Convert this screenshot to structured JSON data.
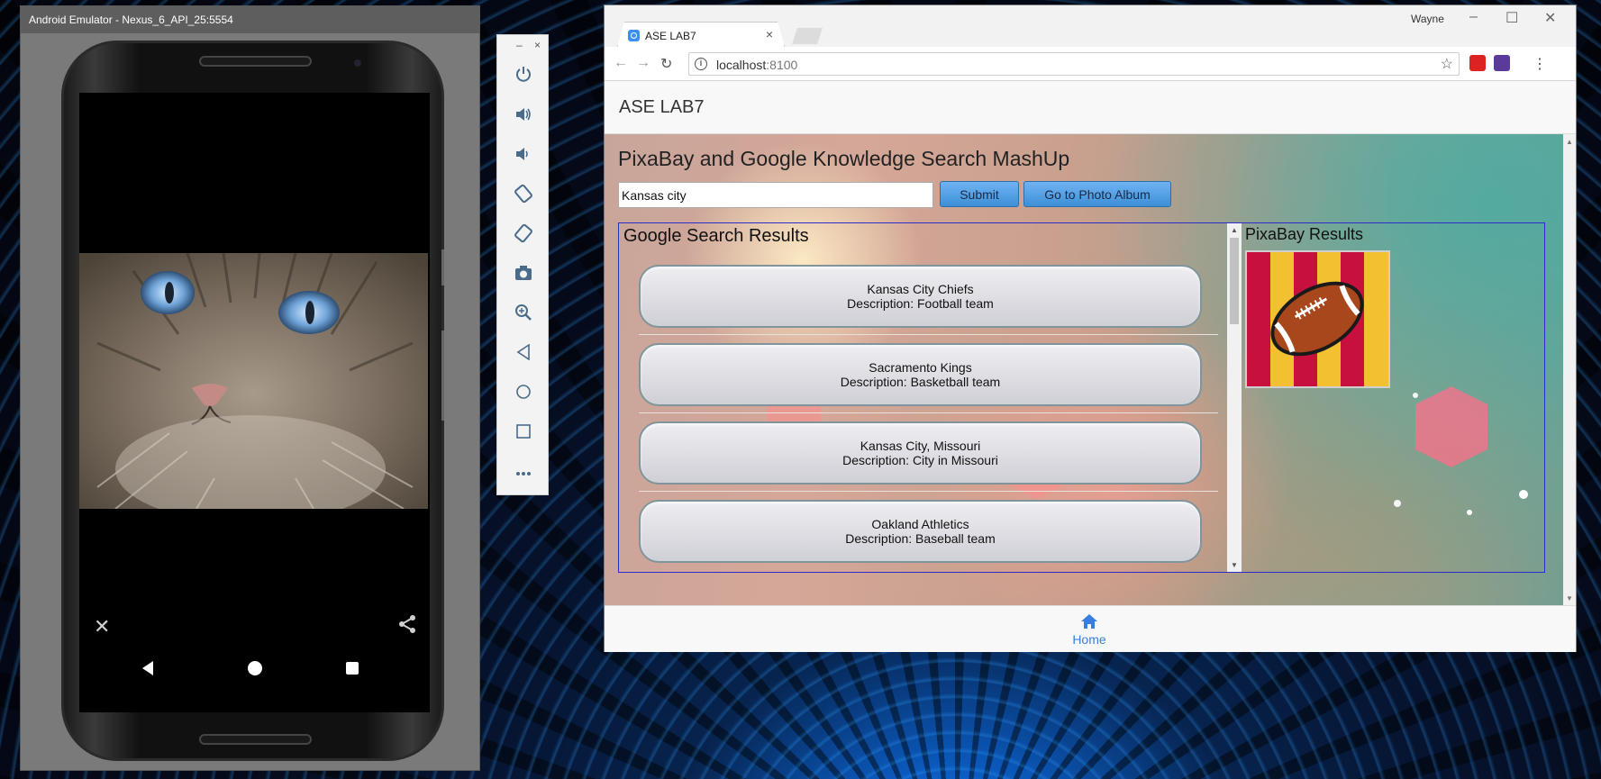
{
  "emulator": {
    "title": "Android Emulator - Nexus_6_API_25:5554",
    "toolbar_window_controls": [
      "–",
      "×"
    ],
    "toolbar_buttons": [
      "power-icon",
      "volume-up-icon",
      "volume-down-icon",
      "rotate-left-icon",
      "rotate-right-icon",
      "camera-icon",
      "zoom-icon",
      "back-icon",
      "home-icon",
      "overview-icon",
      "more-icon"
    ]
  },
  "browser": {
    "tab_title": "ASE LAB7",
    "tab_close": "×",
    "user": "Wayne",
    "url_host": "localhost",
    "url_port": ":8100",
    "window_controls": [
      "–",
      "☐",
      "✕"
    ]
  },
  "app": {
    "header_title": "ASE LAB7",
    "page_title": "PixaBay and Google Knowledge Search MashUp",
    "search_value": "Kansas city",
    "submit_label": "Submit",
    "album_label": "Go to Photo Album",
    "google_title": "Google Search Results",
    "pixabay_title": "PixaBay Results",
    "results": [
      {
        "name": "Kansas City Chiefs",
        "description": "Description: Football team"
      },
      {
        "name": "Sacramento Kings",
        "description": "Description: Basketball team"
      },
      {
        "name": "Kansas City, Missouri",
        "description": "Description: City in Missouri"
      },
      {
        "name": "Oakland Athletics",
        "description": "Description: Baseball team"
      }
    ],
    "home_tab_label": "Home"
  },
  "colors": {
    "accent": "#3a7de0",
    "button_blue": "#3d8fd8",
    "frame_border": "#2c2cc8"
  }
}
